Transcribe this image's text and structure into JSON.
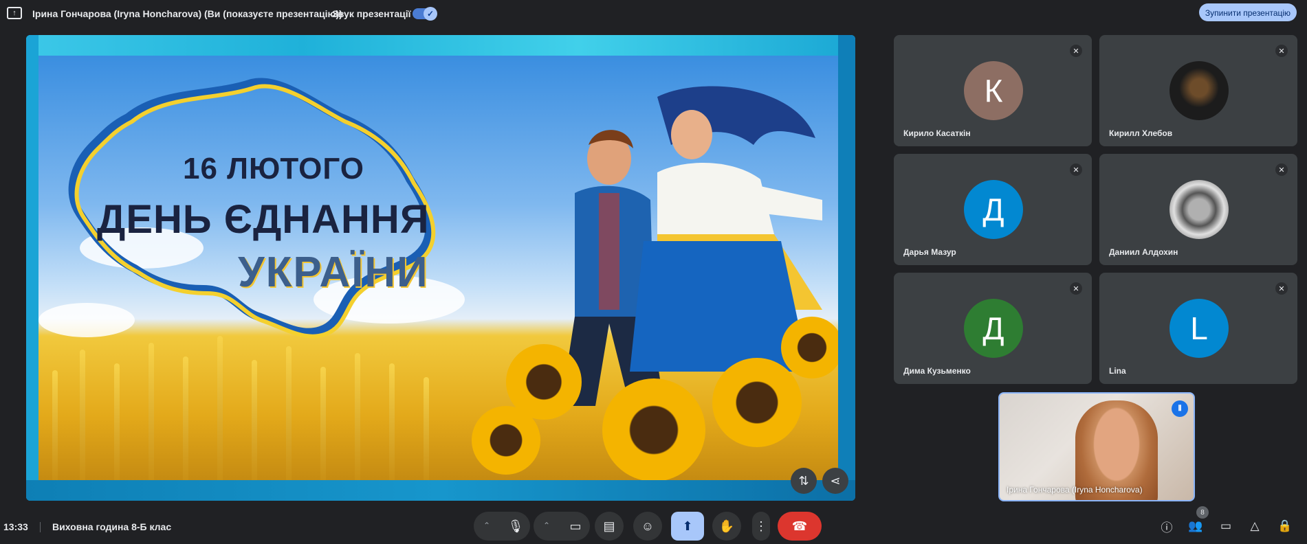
{
  "header": {
    "presenter_title": "Ірина Гончарова (Iryna Honcharova) (Ви (показуєте презентацію))",
    "sound_label": "Звук презентації",
    "stop_button": "Зупинити презентацію"
  },
  "slide": {
    "line1": "16 ЛЮТОГО",
    "line2": "ДЕНЬ ЄДНАННЯ",
    "line3": "УКРАЇНИ"
  },
  "participants": [
    {
      "name": "Кирило Касаткін",
      "initial": "К",
      "color": "#8d6e63",
      "muted": true
    },
    {
      "name": "Кирилл Хлебов",
      "initial": "",
      "color": "#1c1c1c",
      "muted": true
    },
    {
      "name": "Дарья Мазур",
      "initial": "Д",
      "color": "#0288d1",
      "muted": true
    },
    {
      "name": "Даниил Алдохин",
      "initial": "",
      "color": "#e0e0e0",
      "muted": true
    },
    {
      "name": "Дима Кузьменко",
      "initial": "Д",
      "color": "#2e7d32",
      "muted": true
    },
    {
      "name": "Lina",
      "initial": "L",
      "color": "#0288d1",
      "muted": true
    }
  ],
  "self_view": {
    "name": "Ірина Гончарова (Iryna Honcharova)"
  },
  "footer": {
    "time": "13:33",
    "separator": "|",
    "meeting_name": "Виховна година 8-Б клас",
    "participant_count": "8"
  },
  "icons": {
    "mic": "microphone-icon",
    "camera": "camera-icon",
    "captions": "captions-icon",
    "emoji": "emoji-icon",
    "present": "present-screen-icon",
    "hand": "raise-hand-icon",
    "more": "more-vert-icon",
    "end": "end-call-icon",
    "info": "info-icon",
    "people": "people-icon",
    "chat": "chat-icon",
    "activities": "activities-icon",
    "host": "host-controls-icon"
  },
  "colors": {
    "background": "#202124",
    "tile": "#3c4043",
    "accent": "#a8c7fa",
    "end_call": "#dc362e"
  }
}
